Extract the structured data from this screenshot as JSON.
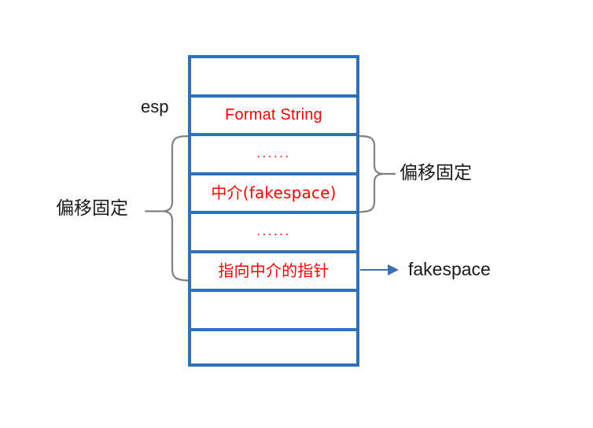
{
  "diagram": {
    "title": "Format String stack layout with fakespace pointer",
    "colors": {
      "box_border": "#2d72b8",
      "cell_text": "#ff0000",
      "annotation_text": "#1a1a1a",
      "brace": "#808080",
      "arrow": "#3a6fb0",
      "background": "#ffffff"
    }
  },
  "stack": {
    "rows": [
      {
        "text": "",
        "kind": "empty"
      },
      {
        "text": "Format String",
        "kind": "label"
      },
      {
        "text": "......",
        "kind": "dots"
      },
      {
        "text": "中介(fakespace)",
        "kind": "label"
      },
      {
        "text": "......",
        "kind": "dots"
      },
      {
        "text": "指向中介的指针",
        "kind": "label"
      },
      {
        "text": "",
        "kind": "empty"
      },
      {
        "text": "",
        "kind": "empty"
      }
    ]
  },
  "annotations": {
    "esp": "esp",
    "left_offset": "偏移固定",
    "right_offset": "偏移固定",
    "fakespace": "fakespace"
  }
}
